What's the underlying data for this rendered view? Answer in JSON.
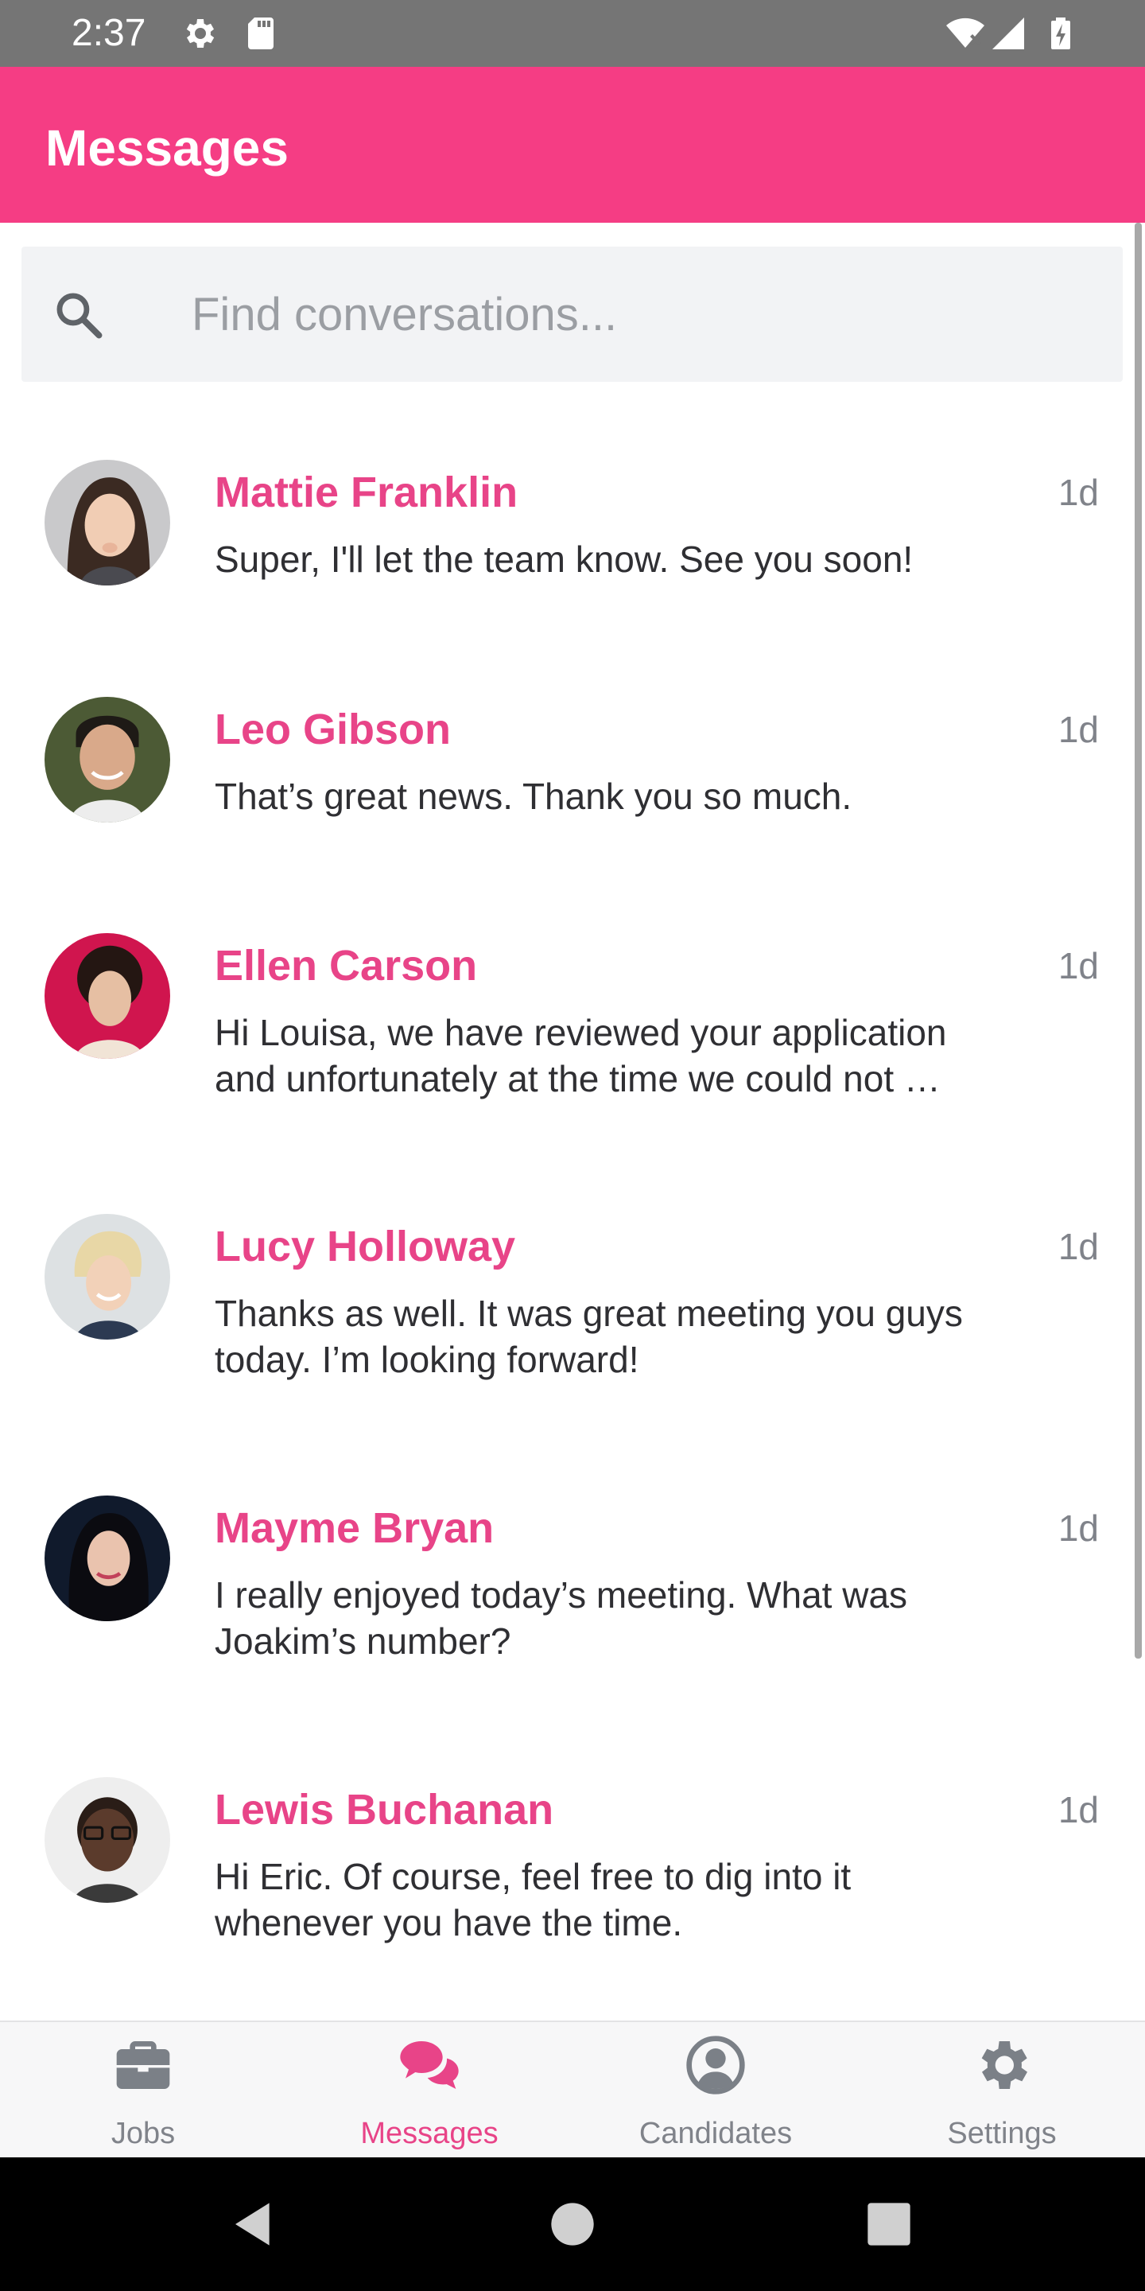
{
  "status_bar": {
    "time": "2:37"
  },
  "header": {
    "title": "Messages"
  },
  "search": {
    "placeholder": "Find conversations..."
  },
  "conversations": [
    {
      "name": "Mattie Franklin",
      "time": "1d",
      "message": "Super, I'll let the team know. See you soon!"
    },
    {
      "name": "Leo Gibson",
      "time": "1d",
      "message": "That’s great news. Thank you so much."
    },
    {
      "name": "Ellen Carson",
      "time": "1d",
      "message": "Hi Louisa, we have reviewed your application and unfortunately at the time we could not …"
    },
    {
      "name": "Lucy Holloway",
      "time": "1d",
      "message": "Thanks as well. It was great meeting you guys today. I’m looking forward!"
    },
    {
      "name": "Mayme Bryan",
      "time": "1d",
      "message": "I really enjoyed today’s meeting. What was Joakim’s number?"
    },
    {
      "name": "Lewis Buchanan",
      "time": "1d",
      "message": "Hi Eric. Of course, feel free to dig into it whenever you have the time."
    }
  ],
  "bottom_nav": {
    "active": "Messages",
    "items": [
      {
        "label": "Jobs",
        "icon": "briefcase-icon"
      },
      {
        "label": "Messages",
        "icon": "chat-bubbles-icon"
      },
      {
        "label": "Candidates",
        "icon": "user-circle-icon"
      },
      {
        "label": "Settings",
        "icon": "gear-icon"
      }
    ]
  },
  "colors": {
    "accent": "#f53d84",
    "name_text": "#e84488",
    "status_bar": "#757575",
    "inactive_nav": "#80838a"
  }
}
